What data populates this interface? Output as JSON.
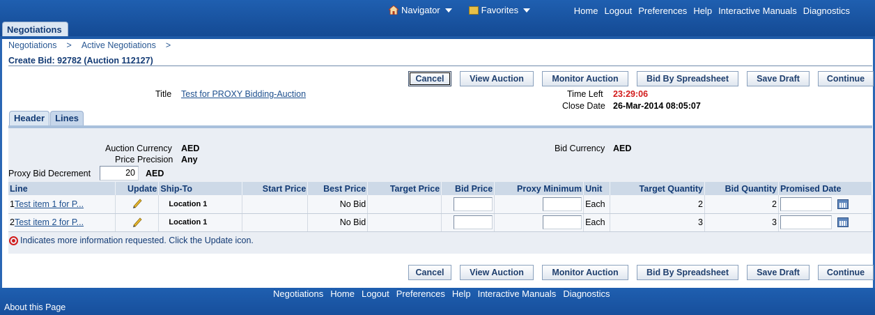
{
  "topnav": {
    "navigator_label": "Navigator",
    "favorites_label": "Favorites",
    "links": [
      "Home",
      "Logout",
      "Preferences",
      "Help",
      "Interactive Manuals",
      "Diagnostics"
    ]
  },
  "main_tab": "Negotiations",
  "breadcrumb": {
    "items": [
      "Negotiations",
      "Active Negotiations"
    ],
    "sep": ">"
  },
  "page_title": "Create Bid: 92782 (Auction 112127)",
  "buttons": {
    "cancel": "Cancel",
    "view_auction": "View Auction",
    "monitor_auction": "Monitor Auction",
    "bid_by_spreadsheet": "Bid By Spreadsheet",
    "save_draft": "Save Draft",
    "continue": "Continue"
  },
  "header_info": {
    "title_label": "Title",
    "title_value": "Test for PROXY Bidding-Auction",
    "time_left_label": "Time Left",
    "time_left_value": "23:29:06",
    "close_date_label": "Close Date",
    "close_date_value": "26-Mar-2014 08:05:07"
  },
  "sub_tabs": [
    "Header",
    "Lines"
  ],
  "lines_info": {
    "auction_currency_label": "Auction Currency",
    "auction_currency_value": "AED",
    "price_precision_label": "Price Precision",
    "price_precision_value": "Any",
    "bid_currency_label": "Bid Currency",
    "bid_currency_value": "AED",
    "proxy_bid_decrement_label": "Proxy Bid Decrement",
    "proxy_bid_decrement_value": "20",
    "proxy_bid_decrement_currency": "AED"
  },
  "table": {
    "headers": [
      "Line",
      "Update",
      "Ship-To",
      "Start Price",
      "Best Price",
      "Target Price",
      "Bid Price",
      "Proxy Minimum",
      "Unit",
      "Target Quantity",
      "Bid Quantity",
      "Promised Date"
    ],
    "rows": [
      {
        "num": "1",
        "line": "Test item 1 for P...",
        "ship_to": "Location 1",
        "start_price": "",
        "best_price": "No Bid",
        "target_price": "",
        "unit": "Each",
        "target_quantity": "2",
        "bid_quantity": "2"
      },
      {
        "num": "2",
        "line": "Test item 2 for P...",
        "ship_to": "Location 1",
        "start_price": "",
        "best_price": "No Bid",
        "target_price": "",
        "unit": "Each",
        "target_quantity": "3",
        "bid_quantity": "3"
      }
    ]
  },
  "note_text": "Indicates more information requested. Click the Update icon.",
  "footer": {
    "links": [
      "Negotiations",
      "Home",
      "Logout",
      "Preferences",
      "Help",
      "Interactive Manuals",
      "Diagnostics"
    ],
    "about": "About this Page"
  },
  "colors": {
    "brand_blue": "#1f5fb0",
    "time_left_red": "#d21b1b"
  }
}
